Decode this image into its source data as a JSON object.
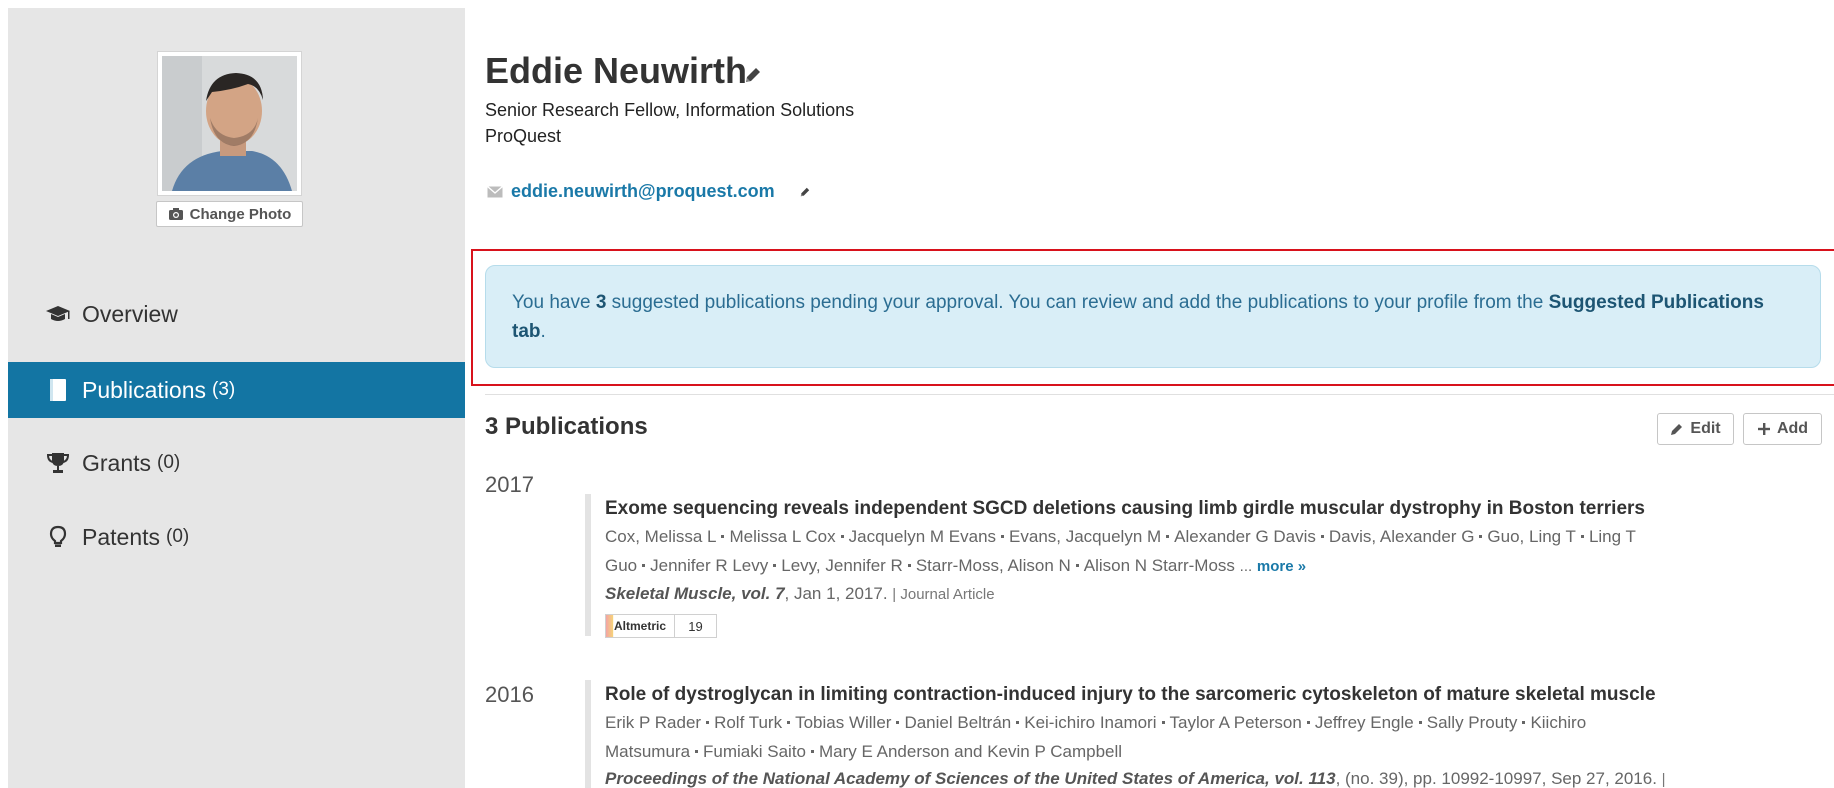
{
  "profile": {
    "name": "Eddie Neuwirth",
    "role": "Senior Research Fellow, Information Solutions",
    "organization": "ProQuest",
    "email": "eddie.neuwirth@proquest.com",
    "change_photo_label": "Change Photo"
  },
  "nav": {
    "overview": {
      "label": "Overview"
    },
    "publications": {
      "label": "Publications",
      "count": "(3)"
    },
    "grants": {
      "label": "Grants",
      "count": "(0)"
    },
    "patents": {
      "label": "Patents",
      "count": "(0)"
    }
  },
  "alert": {
    "prefix": "You have ",
    "count": "3",
    "middle": " suggested publications pending your approval. You can review and add the publications to your profile from the ",
    "link": "Suggested Publications tab",
    "suffix": "."
  },
  "publications": {
    "heading": "3 Publications",
    "edit_label": "Edit",
    "add_label": "Add",
    "items": [
      {
        "year": "2017",
        "title": "Exome sequencing reveals independent SGCD deletions causing limb girdle muscular dystrophy in Boston terriers",
        "authors": [
          "Cox, Melissa L",
          "Melissa L Cox",
          "Jacquelyn M Evans",
          "Evans, Jacquelyn M",
          "Alexander G Davis",
          "Davis, Alexander G",
          "Guo, Ling T",
          "Ling T Guo",
          "Jennifer R Levy",
          "Levy, Jennifer R",
          "Starr-Moss, Alison N",
          "Alison N Starr-Moss"
        ],
        "more_prefix": "...",
        "more_label": "more »",
        "source": "Skeletal Muscle, vol. 7",
        "date": ", Jan 1, 2017.",
        "type": "| Journal Article",
        "altmetric_label": "Altmetric",
        "altmetric_score": "19"
      },
      {
        "year": "2016",
        "title": "Role of dystroglycan in limiting contraction-induced injury to the sarcomeric cytoskeleton of mature skeletal muscle",
        "authors": [
          "Erik P Rader",
          "Rolf Turk",
          "Tobias Willer",
          "Daniel Beltrán",
          "Kei-ichiro Inamori",
          "Taylor A Peterson",
          "Jeffrey Engle",
          "Sally Prouty",
          "Kiichiro Matsumura",
          "Fumiaki Saito",
          "Mary E Anderson and Kevin P Campbell"
        ],
        "source": "Proceedings of the National Academy of Sciences of the United States of America, vol. 113",
        "date": ", (no. 39), pp. 10992-10997, Sep 27, 2016.",
        "type": "|"
      }
    ]
  },
  "colors": {
    "sidebar_bg": "#e6e6e6",
    "active_nav": "#1375a3",
    "link": "#1a79a8",
    "alert_bg": "#d9eef7",
    "highlight_outline": "#d8121c"
  }
}
